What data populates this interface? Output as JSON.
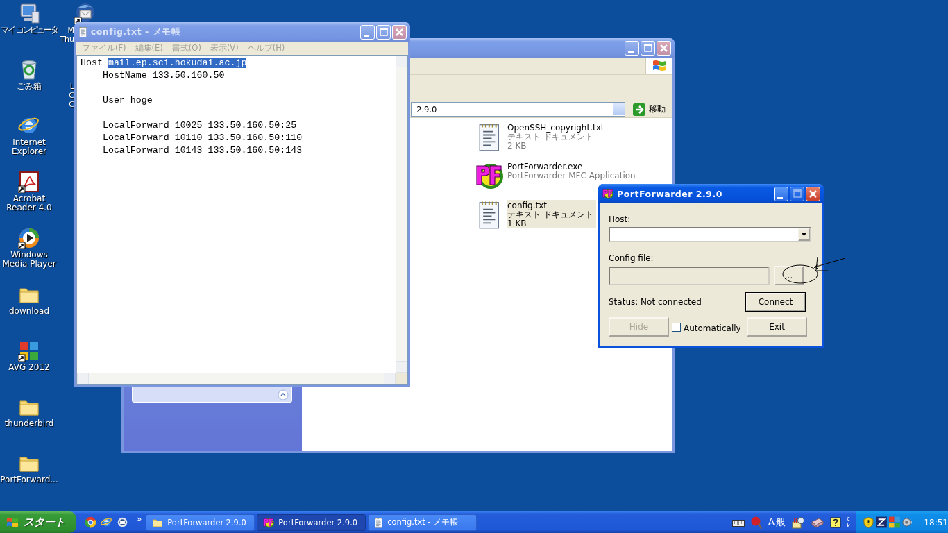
{
  "desktop": {
    "column_1": [
      {
        "kind": "computer",
        "lines": [
          "マイ コンピュータ"
        ],
        "shortcut": false
      },
      {
        "kind": "recycle",
        "lines": [
          "ごみ箱"
        ],
        "shortcut": false
      },
      {
        "kind": "ie",
        "lines": [
          "Internet",
          "Explorer"
        ],
        "shortcut": false
      },
      {
        "kind": "acrobat",
        "lines": [
          "Acrobat",
          "Reader 4.0"
        ],
        "shortcut": true
      },
      {
        "kind": "wmp",
        "lines": [
          "Windows",
          "Media Player"
        ],
        "shortcut": true
      },
      {
        "kind": "folder",
        "lines": [
          "download"
        ],
        "shortcut": false
      },
      {
        "kind": "avg",
        "lines": [
          "AVG 2012"
        ],
        "shortcut": true
      },
      {
        "kind": "folder",
        "lines": [
          "thunderbird"
        ],
        "shortcut": false
      },
      {
        "kind": "folder",
        "lines": [
          "PortForward..."
        ],
        "shortcut": false
      }
    ],
    "column_2": [
      {
        "kind": "thunderbird",
        "lines": [
          "M",
          "Thu"
        ],
        "shortcut": true
      },
      {
        "kind": "covered",
        "lines": [
          "L",
          "C",
          "C"
        ]
      }
    ]
  },
  "explorer": {
    "active": false,
    "address": "-2.9.0",
    "go_button": "移動",
    "files": [
      {
        "kind": "text",
        "name": "OpenSSH_copyright.txt",
        "type": "テキスト ドキュメント",
        "size": "2 KB",
        "selected": false
      },
      {
        "kind": "app",
        "name": "PortForwarder.exe",
        "type": "PortForwarder MFC Application",
        "selected": false
      },
      {
        "kind": "text",
        "name": "config.txt",
        "type": "テキスト ドキュメント",
        "size": "1 KB",
        "selected": true
      }
    ]
  },
  "notepad": {
    "active": false,
    "title": "config.txt - メモ帳",
    "menu": [
      "ファイル(F)",
      "編集(E)",
      "書式(O)",
      "表示(V)",
      "ヘルプ(H)"
    ],
    "paragraphs": [
      [
        {
          "text": "Host ",
          "selection": "mail.ep.sci.hokudai.ac.jp"
        },
        {
          "text": "    HostName 133.50.160.50"
        }
      ],
      [
        {
          "text": "    User hoge"
        }
      ],
      [
        {
          "text": "    LocalForward 10025 133.50.160.50:25"
        },
        {
          "text": "    LocalForward 10110 133.50.160.50:110"
        },
        {
          "text": "    LocalForward 10143 133.50.160.50:143"
        }
      ]
    ]
  },
  "dialog": {
    "active": true,
    "title": "PortForwarder 2.9.0",
    "maximize_disabled": true,
    "host_label": "Host:",
    "config_label": "Config file:",
    "browse_button": "...",
    "status": "Status: Not connected",
    "connect_button": {
      "label": "Connect",
      "default": true
    },
    "hide_button": {
      "label": "Hide",
      "disabled": true
    },
    "auto_checkbox": {
      "label": "Automatically",
      "checked": false
    },
    "exit_button": {
      "label": "Exit"
    }
  },
  "taskbar": {
    "start": "スタート",
    "chevron": "»",
    "tasks": [
      {
        "kind": "folder",
        "label": "PortForwarder-2.9.0",
        "selected": false
      },
      {
        "kind": "pf",
        "label": "PortForwarder 2.9.0",
        "selected": true
      },
      {
        "kind": "notepad",
        "label": "config.txt - メモ帳",
        "selected": false
      }
    ],
    "ime_mode": "A",
    "ime_kana": "般",
    "ime_letters": [
      "c",
      "k"
    ],
    "clock": "18:51"
  }
}
